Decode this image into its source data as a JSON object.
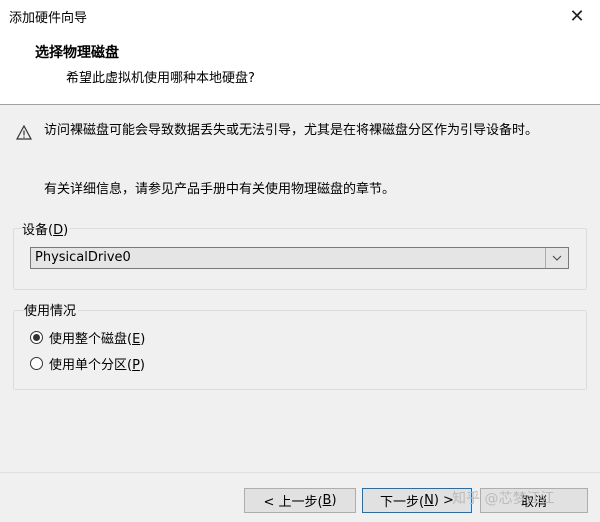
{
  "window": {
    "title": "添加硬件向导",
    "close_icon": "close-icon"
  },
  "header": {
    "title": "选择物理磁盘",
    "subtitle": "希望此虚拟机使用哪种本地硬盘?"
  },
  "warning": {
    "icon": "warning-icon",
    "text": "访问裸磁盘可能会导致数据丢失或无法引导，尤其是在将裸磁盘分区作为引导设备时。"
  },
  "info": {
    "text": "有关详细信息，请参见产品手册中有关使用物理磁盘的章节。"
  },
  "device": {
    "label": "设备(",
    "accel": "D",
    "label_end": ")",
    "selected": "PhysicalDrive0"
  },
  "usage": {
    "label": "使用情况",
    "options": [
      {
        "label": "使用整个磁盘(",
        "accel": "E",
        "label_end": ")",
        "checked": true
      },
      {
        "label": "使用单个分区(",
        "accel": "P",
        "label_end": ")",
        "checked": false
      }
    ]
  },
  "buttons": {
    "back": {
      "label": "< 上一步(",
      "accel": "B",
      "label_end": ")"
    },
    "next": {
      "label": "下一步(",
      "accel": "N",
      "label_end": ") >"
    },
    "cancel": {
      "label": "取消"
    }
  },
  "watermark": "知乎 @芯梦江江",
  "colors": {
    "accent": "#0078d7",
    "background": "#f0f0f0",
    "header_bg": "#ffffff"
  }
}
